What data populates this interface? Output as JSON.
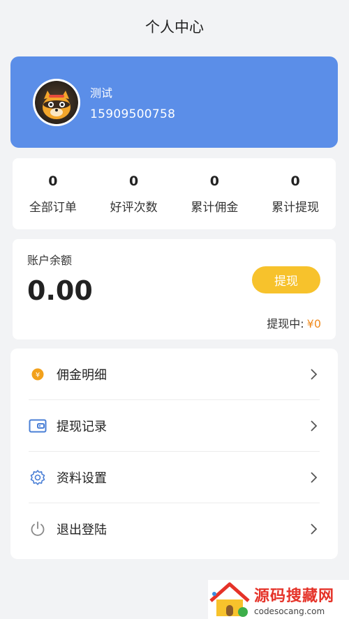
{
  "header": {
    "title": "个人中心"
  },
  "profile": {
    "name": "测试",
    "phone": "15909500758"
  },
  "stats": [
    {
      "value": "0",
      "label": "全部订单"
    },
    {
      "value": "0",
      "label": "好评次数"
    },
    {
      "value": "0",
      "label": "累计佣金"
    },
    {
      "value": "0",
      "label": "累计提现"
    }
  ],
  "balance": {
    "label": "账户余额",
    "amount": "0.00",
    "withdraw_label": "提现",
    "pending_label": "提现中:",
    "pending_value": "¥0"
  },
  "menu": [
    {
      "label": "佣金明细",
      "icon": "coin-icon"
    },
    {
      "label": "提现记录",
      "icon": "wallet-icon"
    },
    {
      "label": "资料设置",
      "icon": "gear-icon"
    },
    {
      "label": "退出登陆",
      "icon": "power-icon"
    }
  ],
  "watermark": {
    "title": "源码搜藏网",
    "url": "codesocang.com"
  },
  "colors": {
    "primary": "#5b8ee8",
    "accent": "#f7c22c",
    "pending": "#f08a1c",
    "coin": "#f2a11c",
    "icon_blue": "#4a7fd6"
  }
}
